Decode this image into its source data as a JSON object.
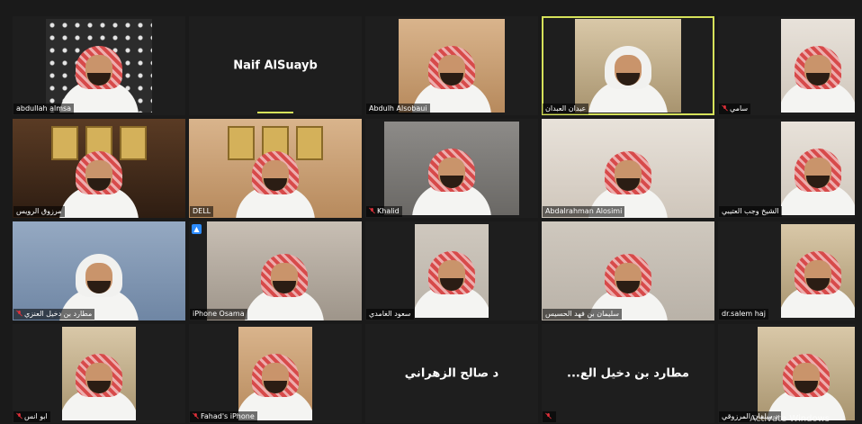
{
  "participants": [
    {
      "name": "abdullah almsa",
      "muted": false
    },
    {
      "name": "Naif AlSuayb",
      "muted": false,
      "video": false
    },
    {
      "name": "Abdulh Alsobaui",
      "muted": false
    },
    {
      "name": "عبدان العبدان",
      "muted": false,
      "active_speaker": true
    },
    {
      "name": "سامي",
      "muted": true
    },
    {
      "name": "مرزوق الرويس",
      "muted": false
    },
    {
      "name": "DELL",
      "muted": false
    },
    {
      "name": "Khalid",
      "muted": true
    },
    {
      "name": "Abdalrahman Alosimi",
      "muted": false
    },
    {
      "name": "الشيخ وجب العتيبي",
      "muted": false
    },
    {
      "name": "مطارد بن دخيل العنزي",
      "muted": true
    },
    {
      "name": "iPhone Osama",
      "muted": false
    },
    {
      "name": "سعود الغامدي",
      "muted": false
    },
    {
      "name": "سليمان بن فهد الحسيس",
      "muted": false
    },
    {
      "name": "dr.salem haj",
      "muted": false
    },
    {
      "name": "ابو انس",
      "muted": true
    },
    {
      "name": "Fahad's iPhone",
      "muted": true
    },
    {
      "name": "د صالح الزهراني",
      "muted": false,
      "video": false
    },
    {
      "name": "...مطارد بن دخيل الع",
      "muted": true,
      "video": false
    },
    {
      "name": "د سلمان المرزوقي",
      "muted": false
    }
  ],
  "watermark": "Activate Windows",
  "colors": {
    "active_speaker_border": "#d6e25a",
    "muted_icon": "#e0303a",
    "tile_bg": "#1e1e1e"
  }
}
